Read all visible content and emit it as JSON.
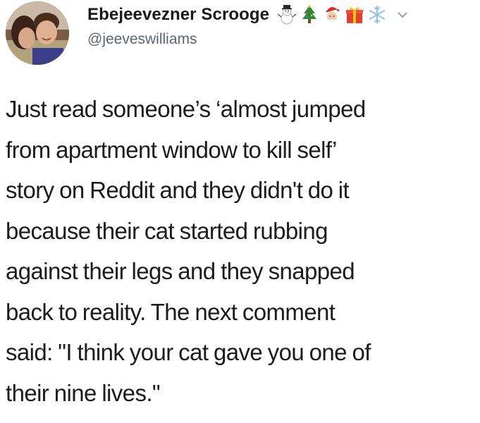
{
  "tweet": {
    "author": {
      "display_name": "Ebejeevezner Scrooge",
      "handle": "@jeeveswilliams",
      "name_emojis": [
        "snowman-icon",
        "christmas-tree-icon",
        "santa-icon",
        "gift-icon",
        "snowflake-icon"
      ]
    },
    "text_lines": [
      "Just read someone’s ‘almost jumped",
      "from apartment window to kill self’",
      "story on Reddit and they didn't do it",
      "because their cat started rubbing",
      "against their legs and they snapped",
      "back to reality. The next comment",
      "said: \"I think your cat gave you one of",
      "their nine lives.\""
    ]
  }
}
